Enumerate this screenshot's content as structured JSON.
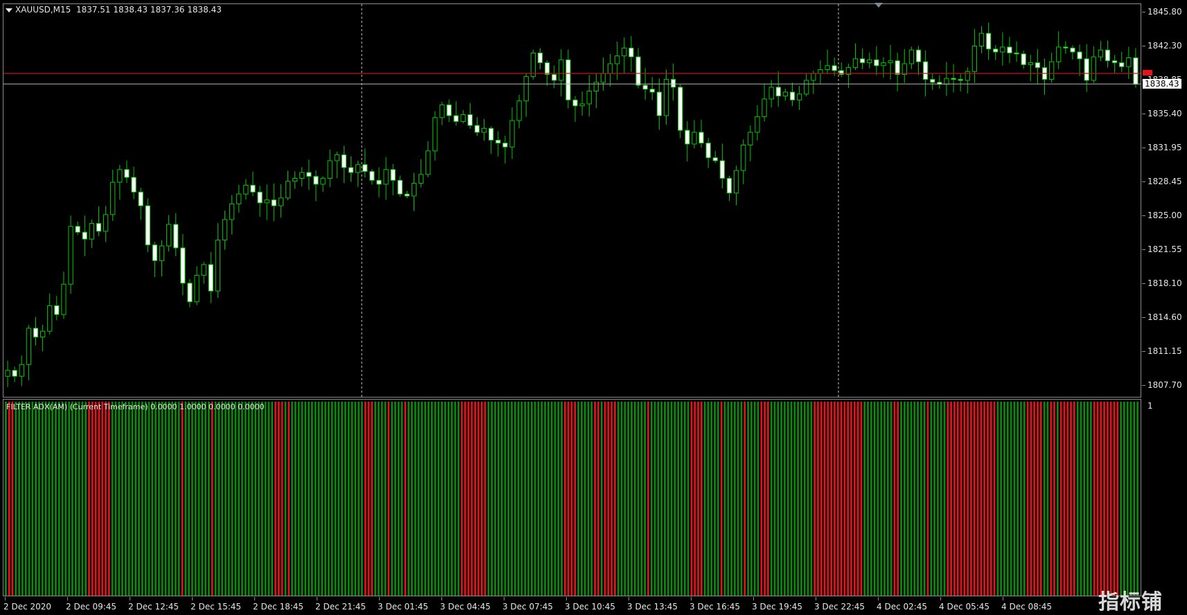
{
  "symbol": {
    "name": "XAUUSD,M15",
    "ohlc": "1837.51 1838.43 1837.36 1838.43"
  },
  "indicator": {
    "label": "FILTER ADX(AM) (Current Timeframe) 0.0000 1.0000 0.0000 0.0000",
    "scale_top": "1"
  },
  "price_axis": [
    "1845.80",
    "1842.30",
    "1838.85",
    "1835.40",
    "1831.95",
    "1828.45",
    "1825.00",
    "1821.55",
    "1818.10",
    "1814.60",
    "1811.15",
    "1807.70"
  ],
  "current_price": "1838.43",
  "time_axis": [
    "2 Dec 2020",
    "2 Dec 09:45",
    "2 Dec 12:45",
    "2 Dec 15:45",
    "2 Dec 18:45",
    "2 Dec 21:45",
    "3 Dec 01:45",
    "3 Dec 04:45",
    "3 Dec 07:45",
    "3 Dec 10:45",
    "3 Dec 13:45",
    "3 Dec 16:45",
    "3 Dec 19:45",
    "3 Dec 22:45",
    "4 Dec 02:45",
    "4 Dec 05:45",
    "4 Dec 08:45"
  ],
  "watermark": "指标铺",
  "colors": {
    "bull": "#00c800",
    "bear_fill": "#ffffff",
    "wick": "#00c800",
    "hist_green": "#0a8c0a",
    "hist_red": "#e8121a",
    "level_red": "#c8121a"
  },
  "chart_data": {
    "type": "candlestick",
    "ylim": [
      1806.0,
      1847.0
    ],
    "close_series": [
      1809.2,
      1808.6,
      1809.8,
      1813.5,
      1812.6,
      1813.2,
      1815.8,
      1814.9,
      1818.0,
      1823.9,
      1823.3,
      1822.6,
      1824.2,
      1823.4,
      1825.1,
      1828.4,
      1829.7,
      1828.9,
      1827.4,
      1826.0,
      1822.0,
      1820.4,
      1821.9,
      1824.1,
      1821.7,
      1818.1,
      1816.2,
      1818.9,
      1820.0,
      1817.3,
      1822.5,
      1824.6,
      1826.2,
      1827.2,
      1828.1,
      1827.4,
      1826.3,
      1826.6,
      1826.0,
      1826.8,
      1828.5,
      1828.8,
      1829.4,
      1829.0,
      1828.2,
      1828.8,
      1830.6,
      1831.2,
      1829.9,
      1829.4,
      1830.2,
      1829.5,
      1828.6,
      1828.2,
      1829.7,
      1828.6,
      1827.2,
      1827.0,
      1828.3,
      1829.2,
      1831.6,
      1835.0,
      1836.3,
      1835.2,
      1834.6,
      1835.3,
      1834.2,
      1833.5,
      1833.9,
      1832.7,
      1832.4,
      1832.0,
      1834.7,
      1836.7,
      1839.2,
      1841.6,
      1840.6,
      1839.4,
      1838.8,
      1840.9,
      1836.8,
      1836.2,
      1836.4,
      1837.7,
      1838.6,
      1839.5,
      1840.5,
      1841.3,
      1842.1,
      1841.2,
      1838.3,
      1837.9,
      1837.6,
      1835.2,
      1838.9,
      1838.1,
      1833.7,
      1832.3,
      1833.5,
      1832.4,
      1830.9,
      1830.6,
      1828.8,
      1827.3,
      1829.6,
      1832.2,
      1833.5,
      1835.1,
      1836.9,
      1838.1,
      1837.2,
      1837.6,
      1836.8,
      1837.4,
      1838.8,
      1839.5,
      1839.9,
      1840.3,
      1839.8,
      1839.4,
      1840.1,
      1841.0,
      1840.6,
      1840.9,
      1840.3,
      1840.6,
      1840.8,
      1839.4,
      1840.5,
      1841.9,
      1840.7,
      1838.9,
      1838.6,
      1838.4,
      1839.0,
      1838.9,
      1838.8,
      1839.7,
      1842.3,
      1843.6,
      1842.0,
      1841.7,
      1842.2,
      1841.6,
      1841.5,
      1840.4,
      1840.6,
      1840.1,
      1838.9,
      1840.7,
      1842.2,
      1842.1,
      1841.7,
      1841.0,
      1838.8,
      1841.2,
      1841.9,
      1840.8,
      1840.6,
      1840.2,
      1841.1,
      1838.4
    ],
    "histogram": "GRRGGGGGGGGGGGGGGGGGGGGGGRRRRRRRGGGGGGGGGGGGGGGGGGGGGRGGGGGGGGRGGGGGGGGGGGGGGGGGGRRRGRGGGGGGGGGGGGGGGGGGGGGGRRRGGGGRGGGGRGGGGGGGGGGGGGGGGRRRRRRRRGGGGGGGGGGGGGGGGGGGGGGGRRRRGGGGGRRGRRRRGGGGGGGGGRGGGGGGGGGGGGRRRRGGGGGRGGGGGGRGGGGRRRGGGGGGGGGGGGGRRRRRRRRRRRRRRRGGGGGGGGGRRGGGGGGGGRGGGGGRRRRRRRRRRRRRRRGGGGGGGGGRRRRRGGRRGRRRRRGGGGGRRRRRRRRGGGGGG"
  }
}
